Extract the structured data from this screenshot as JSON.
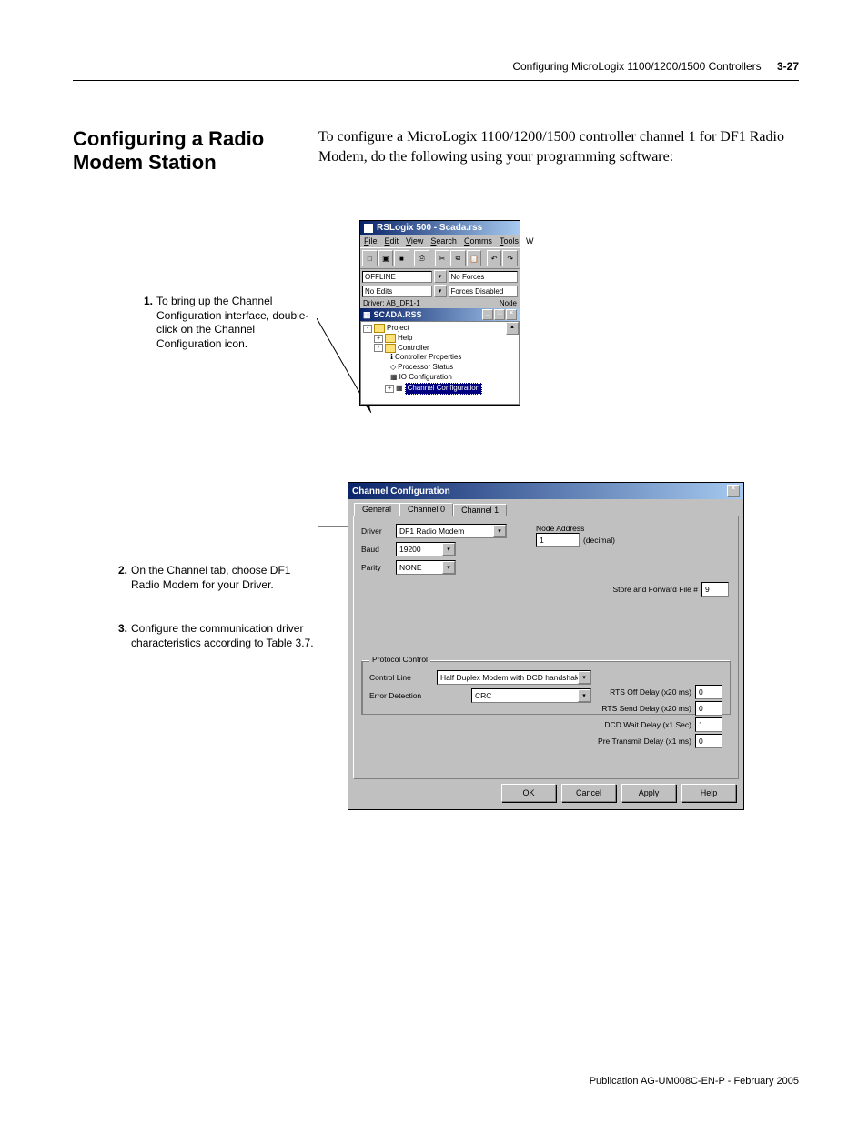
{
  "header": {
    "chapter_title": "Configuring MicroLogix 1100/1200/1500 Controllers",
    "page_number": "3-27"
  },
  "section_title": "Configuring a Radio Modem Station",
  "intro": "To configure a MicroLogix 1100/1200/1500 controller channel 1 for DF1 Radio Modem, do the following using your programming software:",
  "steps": {
    "s1_num": "1.",
    "s1_text": "To bring up the Channel Configuration interface, double-click on the Channel Configuration icon.",
    "s2_num": "2.",
    "s2_text": "On the Channel tab, choose DF1 Radio Modem for your Driver.",
    "s3_num": "3.",
    "s3_text": "Configure the communication driver characteristics according to Table 3.7."
  },
  "win1": {
    "title": "RSLogix 500 - Scada.rss",
    "menu": {
      "file": "File",
      "edit": "Edit",
      "view": "View",
      "search": "Search",
      "comms": "Comms",
      "tools": "Tools",
      "extra": "W"
    },
    "status": {
      "offline": "OFFLINE",
      "noforces": "No Forces",
      "noedits": "No Edits",
      "forces_disabled": "Forces Disabled"
    },
    "driver_row_left": "Driver: AB_DF1-1",
    "driver_row_right": "Node",
    "sub_title": "SCADA.RSS",
    "tree": {
      "project": "Project",
      "help": "Help",
      "controller": "Controller",
      "controller_props": "Controller Properties",
      "processor_status": "Processor Status",
      "io_config": "IO Configuration",
      "channel_config": "Channel Configuration"
    }
  },
  "win2": {
    "title": "Channel Configuration",
    "tabs": {
      "general": "General",
      "ch0": "Channel 0",
      "ch1": "Channel 1"
    },
    "labels": {
      "driver": "Driver",
      "baud": "Baud",
      "parity": "Parity",
      "node_address": "Node Address",
      "decimal": "(decimal)",
      "store_forward": "Store and Forward File #",
      "protocol_control": "Protocol Control",
      "control_line": "Control Line",
      "error_detection": "Error Detection",
      "rts_off": "RTS Off Delay (x20 ms)",
      "rts_send": "RTS Send Delay (x20 ms)",
      "dcd_wait": "DCD Wait Delay (x1 Sec)",
      "pre_transmit": "Pre Transmit Delay (x1 ms)"
    },
    "values": {
      "driver": "DF1 Radio Modem",
      "baud": "19200",
      "parity": "NONE",
      "node_address": "1",
      "store_forward": "9",
      "control_line": "Half Duplex Modem with DCD handshakin",
      "error_detection": "CRC",
      "rts_off": "0",
      "rts_send": "0",
      "dcd_wait": "1",
      "pre_transmit": "0"
    },
    "buttons": {
      "ok": "OK",
      "cancel": "Cancel",
      "apply": "Apply",
      "help": "Help"
    }
  },
  "footer": "Publication AG-UM008C-EN-P - February 2005"
}
